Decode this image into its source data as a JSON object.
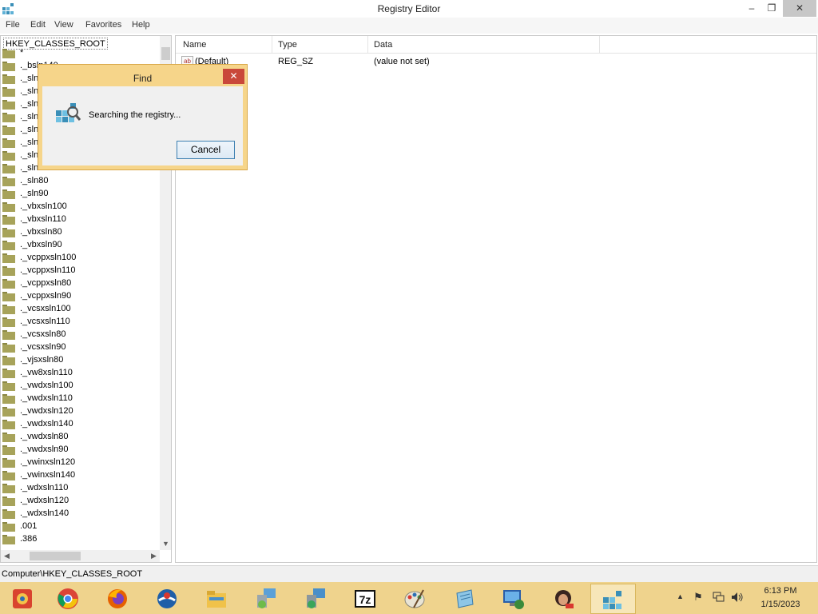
{
  "window": {
    "title": "Registry Editor",
    "controls": {
      "minimize": "–",
      "maximize": "❐",
      "close": "✕"
    }
  },
  "menu": [
    "File",
    "Edit",
    "View",
    "Favorites",
    "Help"
  ],
  "tree": {
    "root": "HKEY_CLASSES_ROOT",
    "items": [
      "*",
      "._bsln140",
      "._sln",
      "._sln",
      "._sln",
      "._sln",
      "._sln",
      "._sln",
      "._sln",
      "._sln71",
      "._sln80",
      "._sln90",
      "._vbxsln100",
      "._vbxsln110",
      "._vbxsln80",
      "._vbxsln90",
      "._vcppxsln100",
      "._vcppxsln110",
      "._vcppxsln80",
      "._vcppxsln90",
      "._vcsxsln100",
      "._vcsxsln110",
      "._vcsxsln80",
      "._vcsxsln90",
      "._vjsxsln80",
      "._vw8xsln110",
      "._vwdxsln100",
      "._vwdxsln110",
      "._vwdxsln120",
      "._vwdxsln140",
      "._vwdxsln80",
      "._vwdxsln90",
      "._vwinxsln120",
      "._vwinxsln140",
      "._wdxsln110",
      "._wdxsln120",
      "._wdxsln140",
      ".001",
      ".386"
    ]
  },
  "list": {
    "columns": [
      "Name",
      "Type",
      "Data"
    ],
    "rows": [
      {
        "name": "(Default)",
        "type": "REG_SZ",
        "data": "(value not set)"
      }
    ]
  },
  "status": "Computer\\HKEY_CLASSES_ROOT",
  "find_dialog": {
    "title": "Find",
    "message": "Searching the registry...",
    "cancel_label": "Cancel",
    "close": "✕"
  },
  "taskbar": {
    "apps": [
      "control-panel-icon",
      "chrome-icon",
      "firefox-icon",
      "opera-icon",
      "file-explorer-icon",
      "setup-icon",
      "network-setup-icon",
      "7zip-icon",
      "paint-icon",
      "notepad-icon",
      "remote-desktop-icon",
      "media-icon",
      "regedit-icon"
    ],
    "time": "6:13 PM",
    "date": "1/15/2023"
  },
  "colors": {
    "taskbar": "#efd38d",
    "dialog_border": "#f6d58a",
    "close_red": "#c9483a",
    "folder": "#a7a35a"
  }
}
